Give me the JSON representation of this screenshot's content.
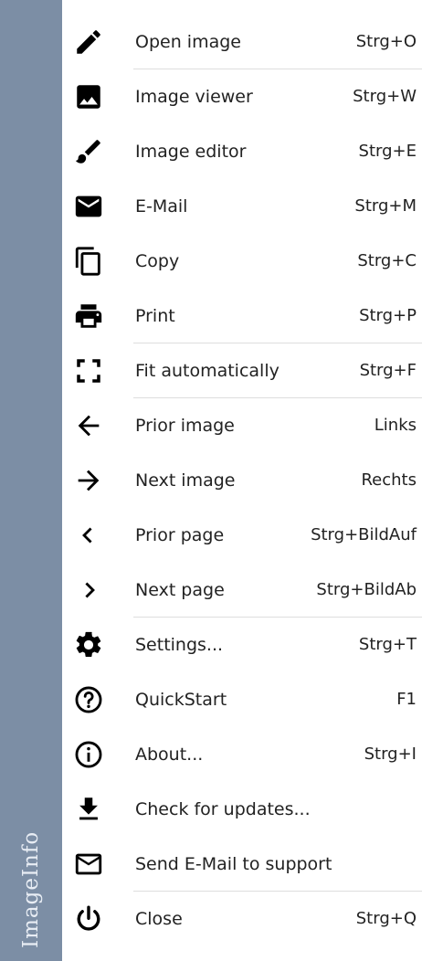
{
  "sidebar": {
    "title": "ImageInfo"
  },
  "menu": {
    "items": [
      {
        "label": "Open image",
        "shortcut": "Strg+O",
        "icon": "pencil-icon"
      },
      {
        "label": "Image viewer",
        "shortcut": "Strg+W",
        "icon": "image-icon"
      },
      {
        "label": "Image editor",
        "shortcut": "Strg+E",
        "icon": "brush-icon"
      },
      {
        "label": "E-Mail",
        "shortcut": "Strg+M",
        "icon": "envelope-icon"
      },
      {
        "label": "Copy",
        "shortcut": "Strg+C",
        "icon": "copy-icon"
      },
      {
        "label": "Print",
        "shortcut": "Strg+P",
        "icon": "printer-icon"
      },
      {
        "label": "Fit automatically",
        "shortcut": "Strg+F",
        "icon": "fit-screen-icon"
      },
      {
        "label": "Prior image",
        "shortcut": "Links",
        "icon": "arrow-left-icon"
      },
      {
        "label": "Next image",
        "shortcut": "Rechts",
        "icon": "arrow-right-icon"
      },
      {
        "label": "Prior page",
        "shortcut": "Strg+BildAuf",
        "icon": "chevron-left-icon"
      },
      {
        "label": "Next page",
        "shortcut": "Strg+BildAb",
        "icon": "chevron-right-icon"
      },
      {
        "label": "Settings...",
        "shortcut": "Strg+T",
        "icon": "gear-icon"
      },
      {
        "label": "QuickStart",
        "shortcut": "F1",
        "icon": "help-icon"
      },
      {
        "label": "About...",
        "shortcut": "Strg+I",
        "icon": "info-icon"
      },
      {
        "label": "Check for updates...",
        "shortcut": "",
        "icon": "download-icon"
      },
      {
        "label": "Send E-Mail to support",
        "shortcut": "",
        "icon": "mail-outline-icon"
      },
      {
        "label": "Close",
        "shortcut": "Strg+Q",
        "icon": "power-icon"
      }
    ]
  }
}
